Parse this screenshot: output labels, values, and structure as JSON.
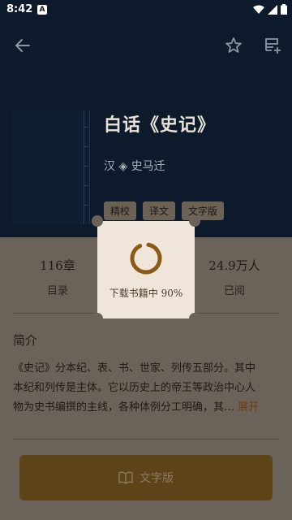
{
  "status_bar": {
    "time": "8:42",
    "notification_letter": "A"
  },
  "book": {
    "title": "白话《史记》",
    "author": "汉 ◈ 史马迁",
    "tags": [
      "精校",
      "译文",
      "文字版"
    ]
  },
  "stats": [
    {
      "value": "116章",
      "label": "目录"
    },
    {
      "value": "24.9万人",
      "label": "已阅"
    }
  ],
  "intro": {
    "heading": "简介",
    "lines": [
      "《史记》分本纪、表、书、世家、列传五部分。其中",
      "本纪和列传是主体。它以历史上的帝王等政治中心人",
      "物为史书编撰的主线，各种体例分工明确，其…"
    ],
    "expand_label": "展开"
  },
  "read_button": {
    "label": "文字版",
    "icon": "book-icon"
  },
  "loading_dialog": {
    "text": "下载书籍中 90%",
    "progress_percent": 90
  },
  "colors": {
    "header_bg": "#0c1a2c",
    "overlay_bg": "#6b6259",
    "accent": "#5c4318",
    "dialog_bg": "#efe5da"
  }
}
